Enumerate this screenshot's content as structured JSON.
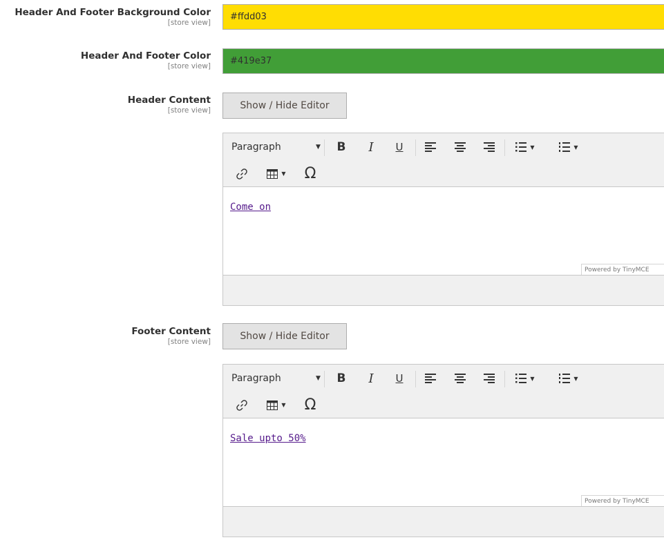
{
  "scope_label": "[store view]",
  "fields": {
    "bg_color": {
      "label": "Header And Footer Background Color",
      "value": "#ffdd03",
      "swatch": "#ffdd03"
    },
    "text_color": {
      "label": "Header And Footer Color",
      "value": "#419e37",
      "swatch": "#419e37"
    },
    "header_content": {
      "label": "Header Content",
      "toggle_label": "Show / Hide Editor",
      "content_text": "Come on"
    },
    "footer_content": {
      "label": "Footer Content",
      "toggle_label": "Show / Hide Editor",
      "content_text": "Sale upto 50%"
    }
  },
  "editor": {
    "format_label": "Paragraph",
    "bold_label": "B",
    "italic_label": "I",
    "underline_label": "U",
    "charmap_label": "Ω",
    "powered_by": "Powered by TinyMCE"
  }
}
